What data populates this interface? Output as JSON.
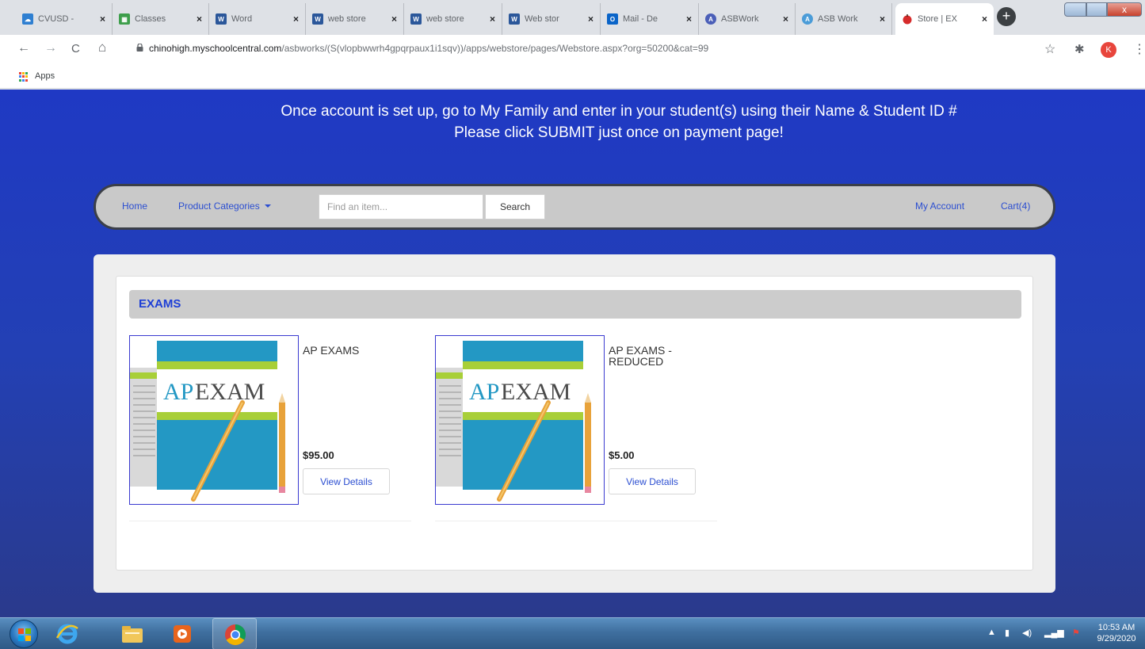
{
  "browser": {
    "tabs": [
      {
        "title": "CVUSD - ",
        "favicon_color": "#2f7fd1"
      },
      {
        "title": "Classes",
        "favicon_color": "#3d9e4b"
      },
      {
        "title": "Word",
        "favicon_color": "#2b579a"
      },
      {
        "title": "web store",
        "favicon_color": "#2b579a"
      },
      {
        "title": "web store",
        "favicon_color": "#2b579a"
      },
      {
        "title": "Web stor",
        "favicon_color": "#2b579a"
      },
      {
        "title": "Mail - De",
        "favicon_color": "#0a64c8"
      },
      {
        "title": "ASBWork",
        "favicon_color": "#4b5fb8"
      },
      {
        "title": "ASB Work",
        "favicon_color": "#4b9cd8"
      },
      {
        "title": "Store | EX",
        "favicon_color": "#d62b2b"
      }
    ],
    "tab_close_glyph": "×",
    "new_tab_glyph": "+",
    "close_window_glyph": "x",
    "url_host": "chinohigh.myschoolcentral.com",
    "url_path": "/asbworks/(S(vlopbwwrh4gpqrpaux1i1sqv))/apps/webstore/pages/Webstore.aspx?org=50200&cat=99",
    "profile_initial": "K",
    "back_glyph": "←",
    "forward_glyph": "→",
    "reload_glyph": "C",
    "home_glyph": "⌂",
    "star_glyph": "☆",
    "extensions_glyph": "✱",
    "menu_glyph": "⋮",
    "bookmarks_apps_label": "Apps"
  },
  "notice": {
    "line1": "Once account is set up, go to My Family and enter in your student(s) using their Name & Student ID #",
    "line2": "Please click SUBMIT just once on payment page!"
  },
  "nav": {
    "home": "Home",
    "categories": "Product Categories",
    "search_placeholder": "Find an item...",
    "search_button": "Search",
    "account": "My Account",
    "cart": "Cart(4)"
  },
  "section": {
    "title": "EXAMS"
  },
  "products": [
    {
      "name": "AP EXAMS",
      "price": "$95.00",
      "button": "View Details",
      "image_text": {
        "ap": "AP",
        "exam": "EXAM"
      }
    },
    {
      "name": "AP EXAMS - REDUCED",
      "price": "$5.00",
      "button": "View Details",
      "image_text": {
        "ap": "AP",
        "exam": "EXAM"
      }
    }
  ],
  "taskbar": {
    "time": "10:53 AM",
    "date": "9/29/2020"
  },
  "colors": {
    "page_blue": "#1f39c4",
    "link_blue": "#2b4ed1",
    "section_title": "#1e3fd6",
    "book_teal": "#2398c4",
    "book_lime": "#a8cf38"
  }
}
